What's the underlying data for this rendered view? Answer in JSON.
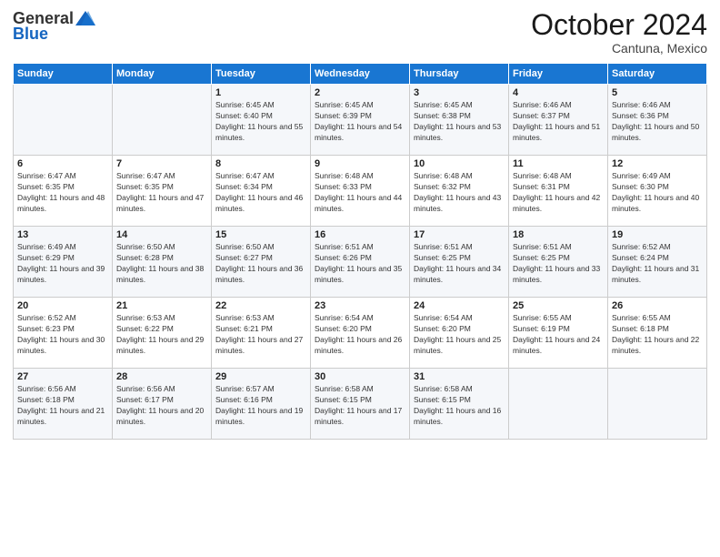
{
  "logo": {
    "general": "General",
    "blue": "Blue"
  },
  "header": {
    "month": "October 2024",
    "location": "Cantuna, Mexico"
  },
  "weekdays": [
    "Sunday",
    "Monday",
    "Tuesday",
    "Wednesday",
    "Thursday",
    "Friday",
    "Saturday"
  ],
  "weeks": [
    [
      null,
      null,
      {
        "day": 1,
        "sunrise": "6:45 AM",
        "sunset": "6:40 PM",
        "daylight": "11 hours and 55 minutes."
      },
      {
        "day": 2,
        "sunrise": "6:45 AM",
        "sunset": "6:39 PM",
        "daylight": "11 hours and 54 minutes."
      },
      {
        "day": 3,
        "sunrise": "6:45 AM",
        "sunset": "6:38 PM",
        "daylight": "11 hours and 53 minutes."
      },
      {
        "day": 4,
        "sunrise": "6:46 AM",
        "sunset": "6:37 PM",
        "daylight": "11 hours and 51 minutes."
      },
      {
        "day": 5,
        "sunrise": "6:46 AM",
        "sunset": "6:36 PM",
        "daylight": "11 hours and 50 minutes."
      }
    ],
    [
      {
        "day": 6,
        "sunrise": "6:47 AM",
        "sunset": "6:35 PM",
        "daylight": "11 hours and 48 minutes."
      },
      {
        "day": 7,
        "sunrise": "6:47 AM",
        "sunset": "6:35 PM",
        "daylight": "11 hours and 47 minutes."
      },
      {
        "day": 8,
        "sunrise": "6:47 AM",
        "sunset": "6:34 PM",
        "daylight": "11 hours and 46 minutes."
      },
      {
        "day": 9,
        "sunrise": "6:48 AM",
        "sunset": "6:33 PM",
        "daylight": "11 hours and 44 minutes."
      },
      {
        "day": 10,
        "sunrise": "6:48 AM",
        "sunset": "6:32 PM",
        "daylight": "11 hours and 43 minutes."
      },
      {
        "day": 11,
        "sunrise": "6:48 AM",
        "sunset": "6:31 PM",
        "daylight": "11 hours and 42 minutes."
      },
      {
        "day": 12,
        "sunrise": "6:49 AM",
        "sunset": "6:30 PM",
        "daylight": "11 hours and 40 minutes."
      }
    ],
    [
      {
        "day": 13,
        "sunrise": "6:49 AM",
        "sunset": "6:29 PM",
        "daylight": "11 hours and 39 minutes."
      },
      {
        "day": 14,
        "sunrise": "6:50 AM",
        "sunset": "6:28 PM",
        "daylight": "11 hours and 38 minutes."
      },
      {
        "day": 15,
        "sunrise": "6:50 AM",
        "sunset": "6:27 PM",
        "daylight": "11 hours and 36 minutes."
      },
      {
        "day": 16,
        "sunrise": "6:51 AM",
        "sunset": "6:26 PM",
        "daylight": "11 hours and 35 minutes."
      },
      {
        "day": 17,
        "sunrise": "6:51 AM",
        "sunset": "6:25 PM",
        "daylight": "11 hours and 34 minutes."
      },
      {
        "day": 18,
        "sunrise": "6:51 AM",
        "sunset": "6:25 PM",
        "daylight": "11 hours and 33 minutes."
      },
      {
        "day": 19,
        "sunrise": "6:52 AM",
        "sunset": "6:24 PM",
        "daylight": "11 hours and 31 minutes."
      }
    ],
    [
      {
        "day": 20,
        "sunrise": "6:52 AM",
        "sunset": "6:23 PM",
        "daylight": "11 hours and 30 minutes."
      },
      {
        "day": 21,
        "sunrise": "6:53 AM",
        "sunset": "6:22 PM",
        "daylight": "11 hours and 29 minutes."
      },
      {
        "day": 22,
        "sunrise": "6:53 AM",
        "sunset": "6:21 PM",
        "daylight": "11 hours and 27 minutes."
      },
      {
        "day": 23,
        "sunrise": "6:54 AM",
        "sunset": "6:20 PM",
        "daylight": "11 hours and 26 minutes."
      },
      {
        "day": 24,
        "sunrise": "6:54 AM",
        "sunset": "6:20 PM",
        "daylight": "11 hours and 25 minutes."
      },
      {
        "day": 25,
        "sunrise": "6:55 AM",
        "sunset": "6:19 PM",
        "daylight": "11 hours and 24 minutes."
      },
      {
        "day": 26,
        "sunrise": "6:55 AM",
        "sunset": "6:18 PM",
        "daylight": "11 hours and 22 minutes."
      }
    ],
    [
      {
        "day": 27,
        "sunrise": "6:56 AM",
        "sunset": "6:18 PM",
        "daylight": "11 hours and 21 minutes."
      },
      {
        "day": 28,
        "sunrise": "6:56 AM",
        "sunset": "6:17 PM",
        "daylight": "11 hours and 20 minutes."
      },
      {
        "day": 29,
        "sunrise": "6:57 AM",
        "sunset": "6:16 PM",
        "daylight": "11 hours and 19 minutes."
      },
      {
        "day": 30,
        "sunrise": "6:58 AM",
        "sunset": "6:15 PM",
        "daylight": "11 hours and 17 minutes."
      },
      {
        "day": 31,
        "sunrise": "6:58 AM",
        "sunset": "6:15 PM",
        "daylight": "11 hours and 16 minutes."
      },
      null,
      null
    ]
  ]
}
